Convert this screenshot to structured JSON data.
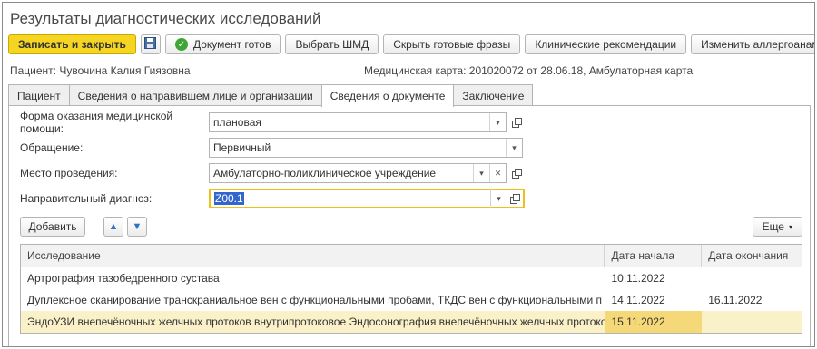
{
  "window": {
    "title": "Результаты диагностических исследований"
  },
  "toolbar": {
    "save_close": "Записать и закрыть",
    "doc_ready": "Документ готов",
    "select_shmd": "Выбрать ШМД",
    "hide_phrases": "Скрыть готовые фразы",
    "clinical": "Клинические рекомендации",
    "allergy": "Изменить аллергоанамнез"
  },
  "info": {
    "patient_label": "Пациент:",
    "patient_value": "Чувочина Калия Гиязовна",
    "card_label": "Медицинская карта:",
    "card_value": "201020072 от 28.06.18, Амбулаторная карта"
  },
  "tabs": [
    {
      "label": "Пациент"
    },
    {
      "label": "Сведения о направившем лице и организации"
    },
    {
      "label": "Сведения о документе"
    },
    {
      "label": "Заключение"
    }
  ],
  "form": {
    "care_form": {
      "label": "Форма оказания медицинской помощи:",
      "value": "плановая"
    },
    "visit": {
      "label": "Обращение:",
      "value": "Первичный"
    },
    "place": {
      "label": "Место проведения:",
      "value": "Амбулаторно-поликлиническое учреждение"
    },
    "diagnosis": {
      "label": "Направительный диагноз:",
      "value": "Z00.1"
    }
  },
  "table_toolbar": {
    "add": "Добавить",
    "more": "Еще"
  },
  "table": {
    "headers": [
      "Исследование",
      "Дата начала",
      "Дата окончания"
    ],
    "rows": [
      {
        "name": "Артрография тазобедренного сустава",
        "start": "10.11.2022",
        "end": ""
      },
      {
        "name": "Дуплексное сканирование транскраниальное вен с функциональными пробами, ТКДС вен с функциональными п",
        "start": "14.11.2022",
        "end": "16.11.2022"
      },
      {
        "name": "ЭндоУЗИ внепечёночных желчных протоков внутрипротоковое Эндосонография внепечёночных желчных протоко",
        "start": "15.11.2022",
        "end": ""
      }
    ]
  },
  "colors": {
    "accent": "#f5d522",
    "selection": "#fbf1c9",
    "focus_border": "#f0c01a"
  }
}
